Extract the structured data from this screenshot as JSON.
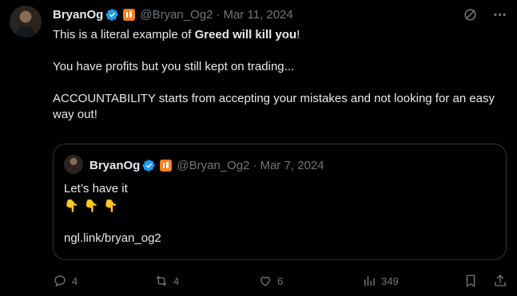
{
  "tweet": {
    "author_name": "BryanOg",
    "handle": "@Bryan_Og2",
    "separator": "·",
    "date": "Mar 11, 2024",
    "line1_pre": "This is a literal example of ",
    "line1_bold": "Greed will kill you",
    "line1_post": "!",
    "line2": "You have profits but you still kept on trading...",
    "line3": "ACCOUNTABILITY starts from accepting your mistakes and not looking for an easy way out!"
  },
  "quote": {
    "author_name": "BryanOg",
    "handle": "@Bryan_Og2",
    "separator": "·",
    "date": "Mar 7, 2024",
    "text": "Let’s have it",
    "emojis": [
      "👇",
      "👇",
      "👇"
    ],
    "link": "ngl.link/bryan_og2"
  },
  "actions": {
    "replies": "4",
    "retweets": "4",
    "likes": "6",
    "views": "349"
  },
  "icons": {
    "verified": "verified-badge-icon",
    "org": "org-badge-icon",
    "grok": "grok-icon",
    "more": "more-icon",
    "reply": "reply-icon",
    "retweet": "retweet-icon",
    "like": "heart-icon",
    "views": "views-icon",
    "bookmark": "bookmark-icon",
    "share": "share-icon"
  },
  "colors": {
    "background": "#000000",
    "text": "#e7e9ea",
    "muted": "#71767b",
    "verified": "#1d9bf0",
    "org_badge": "#f48120",
    "border": "#2f3336"
  }
}
